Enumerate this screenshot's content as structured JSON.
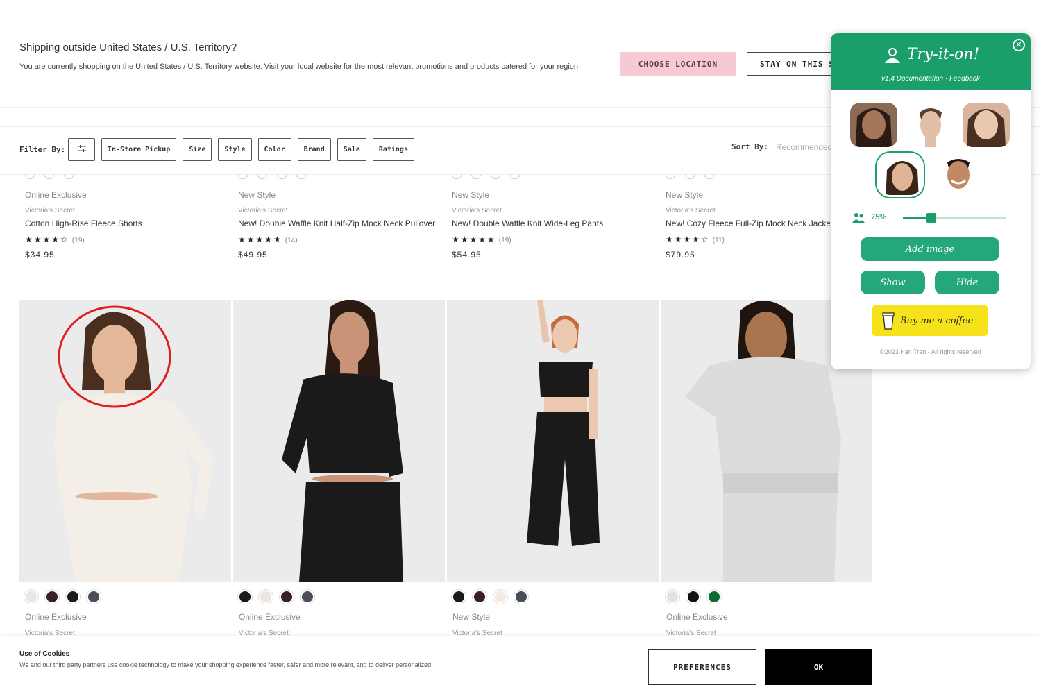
{
  "shipping": {
    "title": "Shipping outside United States / U.S. Territory?",
    "description": "You are currently shopping on the United States / U.S. Territory website. Visit your local website for the most relevant promotions and products catered for your region.",
    "choose_label": "CHOOSE LOCATION",
    "stay_label": "STAY ON THIS SITE"
  },
  "filter": {
    "label": "Filter By:",
    "chips": [
      "In-Store Pickup",
      "Size",
      "Style",
      "Color",
      "Brand",
      "Sale",
      "Ratings"
    ],
    "sort_label": "Sort By:",
    "sort_value": "Recommended"
  },
  "products_top": [
    {
      "badge": "Online Exclusive",
      "brand": "Victoria's Secret",
      "name": "Cotton High-Rise Fleece Shorts",
      "stars": "★★★★☆",
      "count": "(19)",
      "price": "$34.95"
    },
    {
      "badge": "New Style",
      "brand": "Victoria's Secret",
      "name": "New! Double Waffle Knit Half-Zip Mock Neck Pullover",
      "stars": "★★★★★",
      "count": "(14)",
      "price": "$49.95"
    },
    {
      "badge": "New Style",
      "brand": "Victoria's Secret",
      "name": "New! Double Waffle Knit Wide-Leg Pants",
      "stars": "★★★★★",
      "count": "(19)",
      "price": "$54.95"
    },
    {
      "badge": "New Style",
      "brand": "Victoria's Secret",
      "name": "New! Cozy Fleece Full-Zip Mock Neck Jacket",
      "stars": "★★★★☆",
      "count": "(11)",
      "price": "$79.95"
    }
  ],
  "products_bottom": [
    {
      "badge": "Online Exclusive",
      "brand": "Victoria's Secret",
      "swatches": [
        "#ece6e0",
        "#3a1f25",
        "#1a1a1a",
        "#4a4f57"
      ]
    },
    {
      "badge": "Online Exclusive",
      "brand": "Victoria's Secret",
      "swatches": [
        "#1a1a1a",
        "#ece6e0",
        "#3a1f25",
        "#4a4f57"
      ]
    },
    {
      "badge": "New Style",
      "brand": "Victoria's Secret",
      "swatches": [
        "#1a1a1a",
        "#3a1f25",
        "#f1e9e2",
        "#4a4f57"
      ]
    },
    {
      "badge": "Online Exclusive",
      "brand": "Victoria's Secret",
      "swatches": [
        "#e2e2e2",
        "#111111",
        "#0d6b34"
      ]
    }
  ],
  "cookie": {
    "title": "Use of Cookies",
    "text": "We and our third party partners use cookie technology to make your shopping experience faster, safer and more relevant, and to deliver personalized",
    "preferences_label": "PREFERENCES",
    "ok_label": "OK"
  },
  "extension": {
    "title": "Try-it-on!",
    "subtitle": "v1.4 Documentation · Feedback",
    "zoom": "75%",
    "zoom_value": 0.28,
    "add_image_label": "Add image",
    "show_label": "Show",
    "hide_label": "Hide",
    "coffee_label": "Buy me a coffee",
    "footer": "©2023 Han Tran - All rights reserved",
    "accent": "#1a9e6a"
  },
  "colors": {
    "highlight_ring": "#e01e1e",
    "pink_button": "#f7c9d3",
    "coffee_yellow": "#f5e21a"
  }
}
